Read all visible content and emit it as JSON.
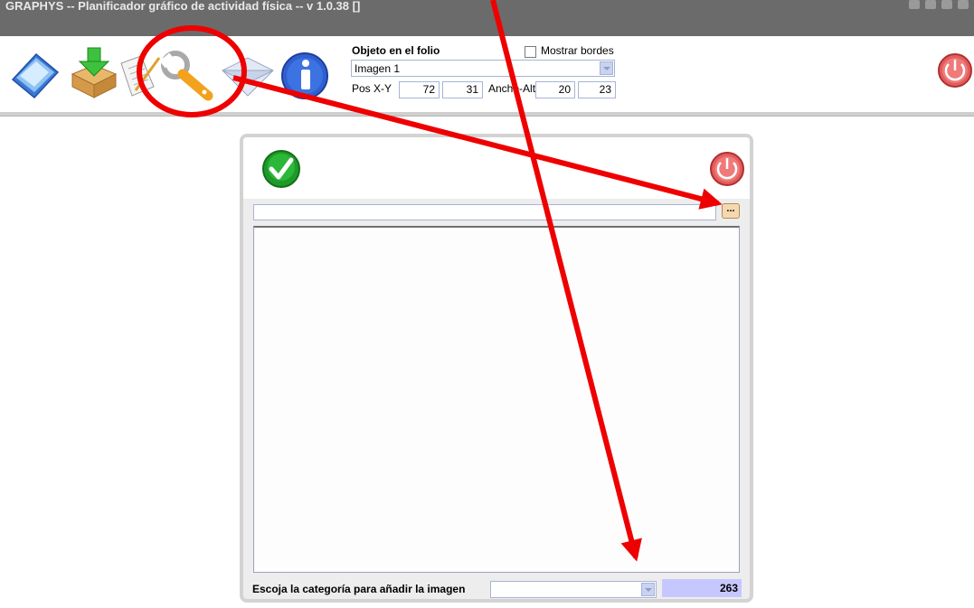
{
  "window": {
    "title": "GRAPHYS -- Planificador gráfico de actividad física -- v 1.0.38  []"
  },
  "toolbar": {
    "icons": [
      "open-icon",
      "install-box-icon",
      "edit-document-icon",
      "wrench-icon",
      "envelope-icon",
      "info-icon",
      "power-icon"
    ]
  },
  "object_panel": {
    "title": "Objeto en el folio",
    "show_borders_label": "Mostrar bordes",
    "show_borders_checked": false,
    "object_value": "Imagen 1",
    "pos_label": "Pos X-Y",
    "pos_x": "72",
    "pos_y": "31",
    "size_label": "Ancho-Alto",
    "width": "20",
    "height": "23"
  },
  "dialog": {
    "path_value": "",
    "browse_label": "...",
    "category_label": "Escoja la categoría para añadir la imagen",
    "category_value": "",
    "count": "263"
  },
  "colors": {
    "annotation": "#ee0000",
    "titlebar": "#6b6b6b",
    "count_bg": "#c7c7ff"
  }
}
